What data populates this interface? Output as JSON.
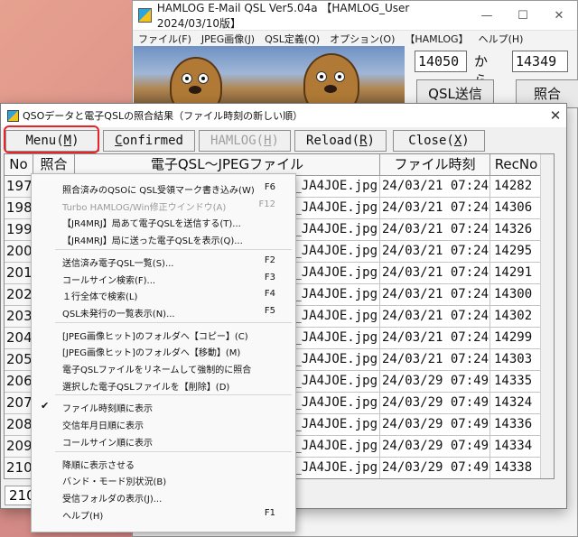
{
  "main_window": {
    "title": "HAMLOG E-Mail QSL Ver5.04a 【HAMLOG_User 2024/03/10版】",
    "controls": {
      "minimize": "—",
      "maximize": "☐",
      "close": "✕"
    },
    "menus": [
      "ファイル(F)",
      "JPEG画像(J)",
      "QSL定義(Q)",
      "オプション(O)",
      "【HAMLOG】",
      "ヘルプ(H)"
    ],
    "range_from": "14050",
    "range_from_label": "から",
    "range_to": "14349",
    "qsl_send_button": "QSL送信",
    "match_button": "照合"
  },
  "dialog": {
    "title": "QSOデータと電子QSLの照合結果（ファイル時刻の新しい順）",
    "close": "✕",
    "toolbar": {
      "menu": {
        "text": "Menu(",
        "key": "M",
        "end": ")"
      },
      "confirmed": {
        "key": "C",
        "text": "onfirmed"
      },
      "hamlog": {
        "text": "HAMLOG(",
        "key": "H",
        "end": ")"
      },
      "reload": {
        "text": "Reload(",
        "key": "R",
        "end": ")"
      },
      "close": {
        "text": "Close(",
        "key": "X",
        "end": ")"
      }
    },
    "columns": [
      "No",
      "照合",
      "電子QSL～JPEGファイル",
      "ファイル時刻",
      "RecNo"
    ],
    "rows": [
      {
        "no": "197",
        "file": "78_JA4JOE.jpg",
        "time": "24/03/21 07:24",
        "rec": "14282"
      },
      {
        "no": "198",
        "file": "_JA4JOE.jpg",
        "time": "24/03/21 07:24",
        "rec": "14306"
      },
      {
        "no": "199",
        "file": "_JA4JOE.jpg",
        "time": "24/03/21 07:24",
        "rec": "14326"
      },
      {
        "no": "200",
        "file": "_JA4JOE.jpg",
        "time": "24/03/21 07:24",
        "rec": "14295"
      },
      {
        "no": "201",
        "file": "_JA4JOE.jpg",
        "time": "24/03/21 07:24",
        "rec": "14291"
      },
      {
        "no": "202",
        "file": "_JA4JOE.jpg",
        "time": "24/03/21 07:24",
        "rec": "14300"
      },
      {
        "no": "203",
        "file": "_JA4JOE.jpg",
        "time": "24/03/21 07:24",
        "rec": "14302"
      },
      {
        "no": "204",
        "file": "_JA4JOE.jpg",
        "time": "24/03/21 07:24",
        "rec": "14299"
      },
      {
        "no": "205",
        "file": "_JA4JOE.jpg",
        "time": "24/03/21 07:24",
        "rec": "14303"
      },
      {
        "no": "206",
        "file": "_JA4JOE.jpg",
        "time": "24/03/29 07:49",
        "rec": "14335"
      },
      {
        "no": "207",
        "file": "_JA4JOE.jpg",
        "time": "24/03/29 07:49",
        "rec": "14324"
      },
      {
        "no": "208",
        "file": "_JA4JOE.jpg",
        "time": "24/03/29 07:49",
        "rec": "14336"
      },
      {
        "no": "209",
        "file": "_JA4JOE.jpg",
        "time": "24/03/29 07:49",
        "rec": "14334"
      },
      {
        "no": "210",
        "file": "_JA4JOE.jpg",
        "time": "24/03/29 07:49",
        "rec": "14338"
      }
    ],
    "status_count": "210"
  },
  "context_menu": {
    "items": [
      {
        "label": "照合済みのQSOに QSL受領マーク書き込み(W)",
        "key": "F6"
      },
      {
        "label": "Turbo HAMLOG/Win修正ウインドウ(A)",
        "key": "F12",
        "disabled": true
      },
      {
        "label": "【JR4MRJ】局あて電子QSLを送信する(T)...",
        "key": ""
      },
      {
        "label": "【JR4MRJ】局に送った電子QSLを表示(Q)...",
        "key": ""
      },
      {
        "label": "送信済み電子QSL一覧(S)...",
        "key": "F2"
      },
      {
        "label": "コールサイン検索(F)...",
        "key": "F3"
      },
      {
        "label": "１行全体で検索(L)",
        "key": "F4"
      },
      {
        "label": "QSL未発行の一覧表示(N)...",
        "key": "F5"
      },
      {
        "label": "[JPEG画像ヒット]のフォルダへ【コピー】(C)",
        "key": ""
      },
      {
        "label": "[JPEG画像ヒット]のフォルダへ【移動】(M)",
        "key": ""
      },
      {
        "label": "電子QSLファイルをリネームして強制的に照合",
        "key": ""
      },
      {
        "label": "選択した電子QSLファイルを【削除】(D)",
        "key": ""
      },
      {
        "label": "ファイル時刻順に表示",
        "key": "",
        "checked": true
      },
      {
        "label": "交信年月日順に表示",
        "key": ""
      },
      {
        "label": "コールサイン順に表示",
        "key": ""
      },
      {
        "label": "降順に表示させる",
        "key": ""
      },
      {
        "label": "バンド・モード別状況(B)",
        "key": ""
      },
      {
        "label": "受信フォルダの表示(J)...",
        "key": ""
      },
      {
        "label": "ヘルプ(H)",
        "key": "F1"
      }
    ],
    "check_mark": "✔"
  },
  "colors": {
    "highlight_border": "#e8242b"
  },
  "icons": [
    "hamlog-app-icon",
    "checkmark-icon",
    "close-icon"
  ]
}
